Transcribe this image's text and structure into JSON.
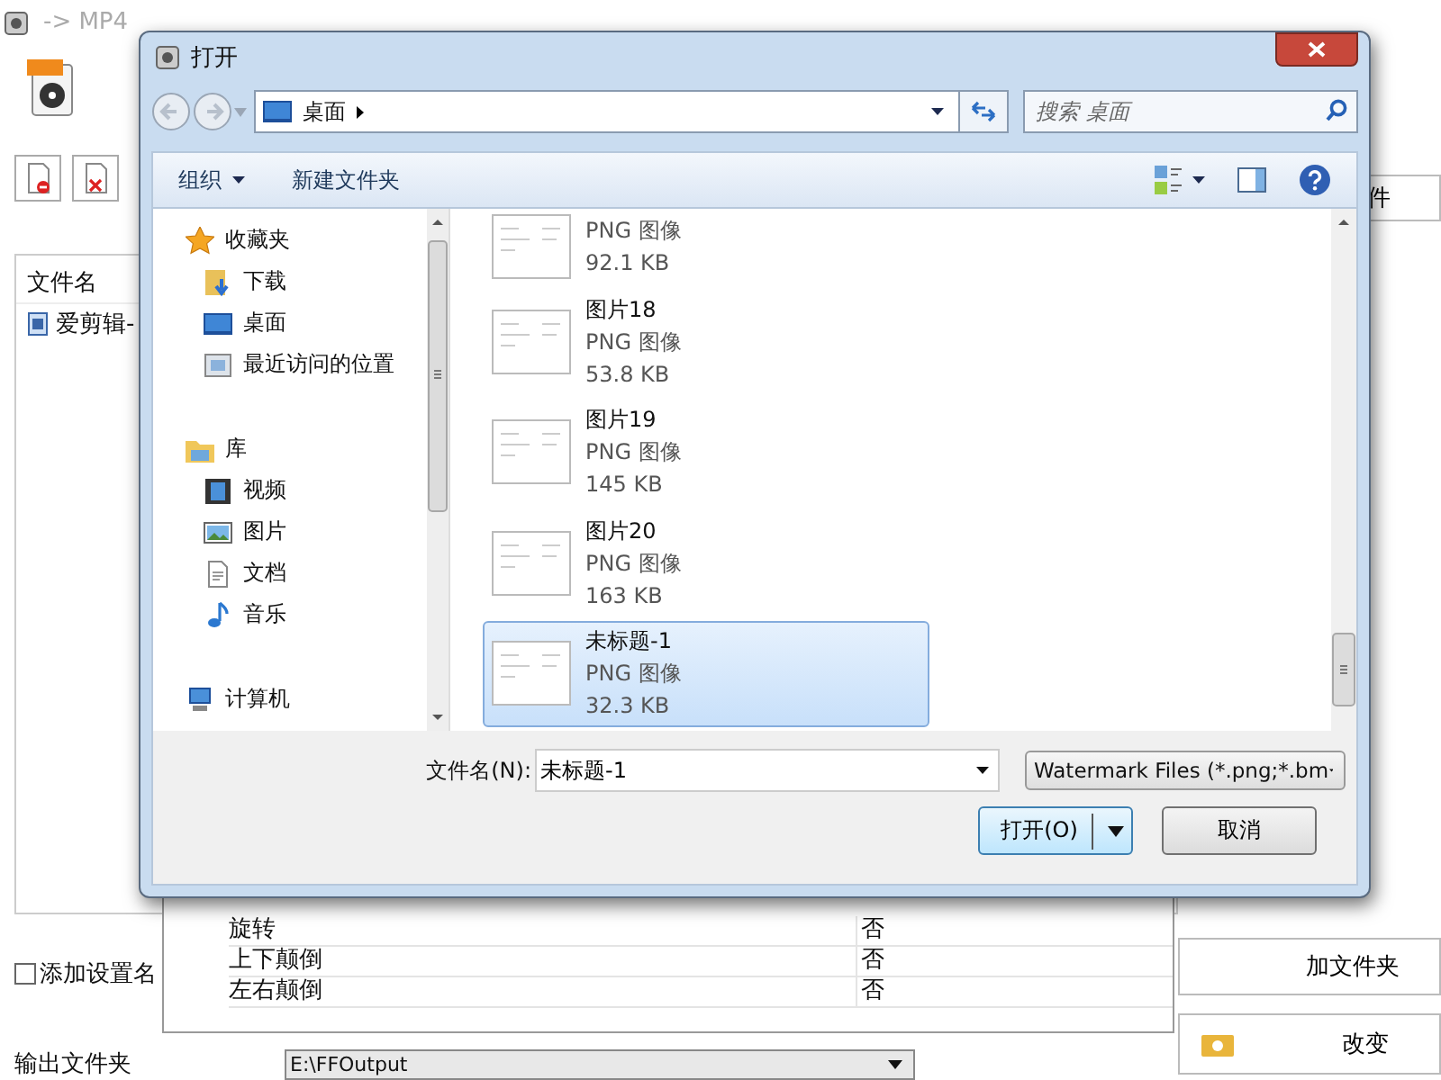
{
  "app": {
    "title": "-> MP4",
    "file_list": {
      "columns": [
        "文件名"
      ],
      "rows": [
        "爱剪辑-"
      ]
    },
    "side_buttons": [
      "件",
      "加文件夹",
      "改变"
    ],
    "add_name_checkbox": {
      "label": "添加设置名",
      "checked": false
    },
    "properties": {
      "rows": [
        {
          "name": "旋转",
          "value": "否"
        },
        {
          "name": "上下颠倒",
          "value": "否"
        },
        {
          "name": "左右颠倒",
          "value": "否"
        }
      ]
    },
    "output_folder": {
      "label": "输出文件夹",
      "value": "E:\\FFOutput"
    }
  },
  "dialog": {
    "title": "打开",
    "address": "桌面",
    "search": {
      "placeholder": "搜索 桌面"
    },
    "toolbar": [
      "组织",
      "新建文件夹"
    ],
    "nav": [
      {
        "label": "收藏夹",
        "children": [
          {
            "label": "下载"
          },
          {
            "label": "桌面"
          },
          {
            "label": "最近访问的位置"
          }
        ]
      },
      {
        "label": "库",
        "children": [
          {
            "label": "视频"
          },
          {
            "label": "图片"
          },
          {
            "label": "文档"
          },
          {
            "label": "音乐"
          }
        ]
      },
      {
        "label": "计算机"
      }
    ],
    "files": [
      {
        "type": "PNG 图像",
        "size": "92.1 KB",
        "selected": false
      },
      {
        "name": "图片18",
        "type": "PNG 图像",
        "size": "53.8 KB",
        "selected": false
      },
      {
        "name": "图片19",
        "type": "PNG 图像",
        "size": "145 KB",
        "selected": false
      },
      {
        "name": "图片20",
        "type": "PNG 图像",
        "size": "163 KB",
        "selected": false
      },
      {
        "name": "未标题-1",
        "type": "PNG 图像",
        "size": "32.3 KB",
        "selected": true
      }
    ],
    "filename": {
      "label": "文件名(N):",
      "value": "未标题-1"
    },
    "filter": "Watermark Files (*.png;*.bm",
    "buttons": [
      {
        "label": "打开(O)",
        "kind": "split"
      },
      {
        "label": "取消",
        "kind": "plain"
      }
    ]
  }
}
